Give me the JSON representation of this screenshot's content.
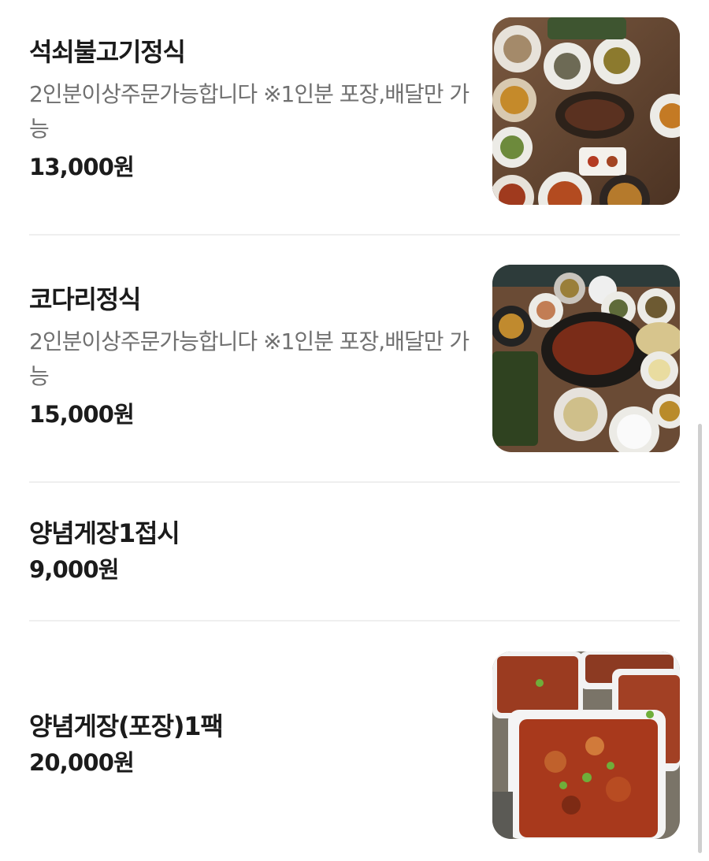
{
  "menu": {
    "items": [
      {
        "name": "석쇠불고기정식",
        "description": "2인분이상주문가능합니다 ※1인분 포장,배달만 가능",
        "price": "13,000원"
      },
      {
        "name": "코다리정식",
        "description": "2인분이상주문가능합니다 ※1인분 포장,배달만 가능",
        "price": "15,000원"
      },
      {
        "name": "양념게장1접시",
        "price": "9,000원"
      },
      {
        "name": "양념게장(포장)1팩",
        "price": "20,000원"
      }
    ]
  },
  "colors": {
    "text_primary": "#1b1b1b",
    "text_secondary": "#707070",
    "divider": "#efefef",
    "scrollbar": "#cfcfcf"
  }
}
